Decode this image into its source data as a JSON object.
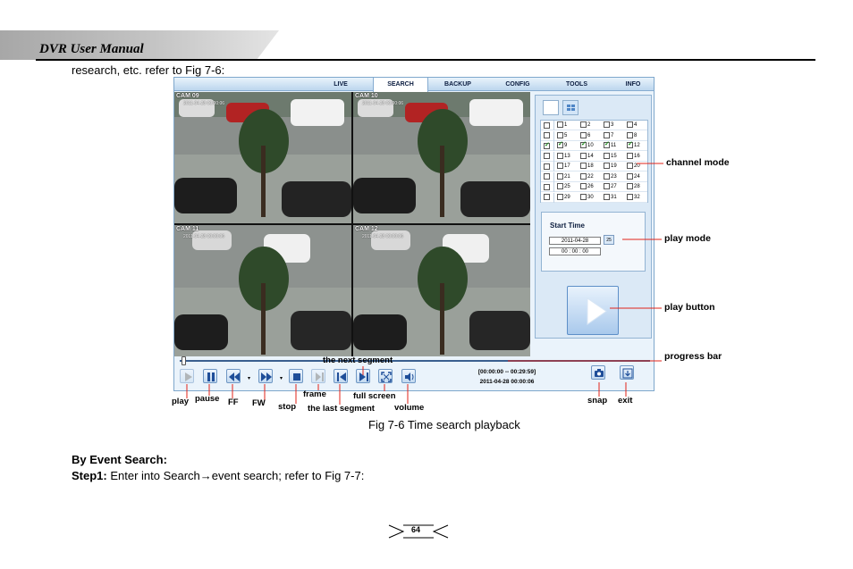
{
  "header": {
    "title": "DVR User Manual"
  },
  "intro_text": "research, etc. refer to Fig 7-6:",
  "dvr": {
    "tabs": [
      {
        "label": "LIVE",
        "active": false
      },
      {
        "label": "SEARCH",
        "active": true
      },
      {
        "label": "BACKUP",
        "active": false
      },
      {
        "label": "CONFIG",
        "active": false
      },
      {
        "label": "TOOLS",
        "active": false
      },
      {
        "label": "INFO",
        "active": false
      }
    ],
    "cameras": [
      {
        "label": "CAM 09",
        "date": "2011-04-28  00:00:06"
      },
      {
        "label": "CAM 10",
        "date": "2011-04-28  00:00:06"
      },
      {
        "label": "CAM 11",
        "date": "2011-04-28  00:00:06"
      },
      {
        "label": "CAM 12",
        "date": "2011-04-28  00:00:06"
      }
    ],
    "channels": [
      {
        "all": false,
        "items": [
          {
            "n": "1",
            "on": false
          },
          {
            "n": "2",
            "on": false
          },
          {
            "n": "3",
            "on": false
          },
          {
            "n": "4",
            "on": false
          }
        ]
      },
      {
        "all": false,
        "items": [
          {
            "n": "5",
            "on": false
          },
          {
            "n": "6",
            "on": false
          },
          {
            "n": "7",
            "on": false
          },
          {
            "n": "8",
            "on": false
          }
        ]
      },
      {
        "all": true,
        "items": [
          {
            "n": "9",
            "on": true
          },
          {
            "n": "10",
            "on": true
          },
          {
            "n": "11",
            "on": true
          },
          {
            "n": "12",
            "on": true
          }
        ]
      },
      {
        "all": false,
        "items": [
          {
            "n": "13",
            "on": false
          },
          {
            "n": "14",
            "on": false
          },
          {
            "n": "15",
            "on": false
          },
          {
            "n": "16",
            "on": false
          }
        ]
      },
      {
        "all": false,
        "items": [
          {
            "n": "17",
            "on": false
          },
          {
            "n": "18",
            "on": false
          },
          {
            "n": "19",
            "on": false
          },
          {
            "n": "20",
            "on": false
          }
        ]
      },
      {
        "all": false,
        "items": [
          {
            "n": "21",
            "on": false
          },
          {
            "n": "22",
            "on": false
          },
          {
            "n": "23",
            "on": false
          },
          {
            "n": "24",
            "on": false
          }
        ]
      },
      {
        "all": false,
        "items": [
          {
            "n": "25",
            "on": false
          },
          {
            "n": "26",
            "on": false
          },
          {
            "n": "27",
            "on": false
          },
          {
            "n": "28",
            "on": false
          }
        ]
      },
      {
        "all": false,
        "items": [
          {
            "n": "29",
            "on": false
          },
          {
            "n": "30",
            "on": false
          },
          {
            "n": "31",
            "on": false
          },
          {
            "n": "32",
            "on": false
          }
        ]
      }
    ],
    "start_time": {
      "label": "Start Time",
      "date": "2011-04-28",
      "time": "00 : 00 : 00",
      "calendar_day": "25"
    },
    "progress": 0.0,
    "playback": {
      "range": "[00:00:00 -- 00:29:59]",
      "datetime": "2011-04-28 00:00:06"
    }
  },
  "annotations": {
    "channel_mode": "channel mode",
    "play_mode": "play mode",
    "play_button": "play button",
    "progress_bar": "progress bar",
    "next_segment": "the next segment",
    "play": "play",
    "pause": "pause",
    "ff": "FF",
    "fw": "FW",
    "stop": "stop",
    "frame": "frame",
    "last_segment": "the last segment",
    "full_screen": "full screen",
    "volume": "volume",
    "snap": "snap",
    "exit": "exit"
  },
  "caption": "Fig 7-6 Time search playback",
  "section": {
    "heading": "By Event Search:",
    "step_label": "Step1:",
    "step_text": " Enter into Search→event search; refer to Fig 7-7:"
  },
  "page_number": "64",
  "colors": {
    "accent": "#1a56a8",
    "panel": "#dbe9f6",
    "annotation_line": "#e2231a"
  }
}
